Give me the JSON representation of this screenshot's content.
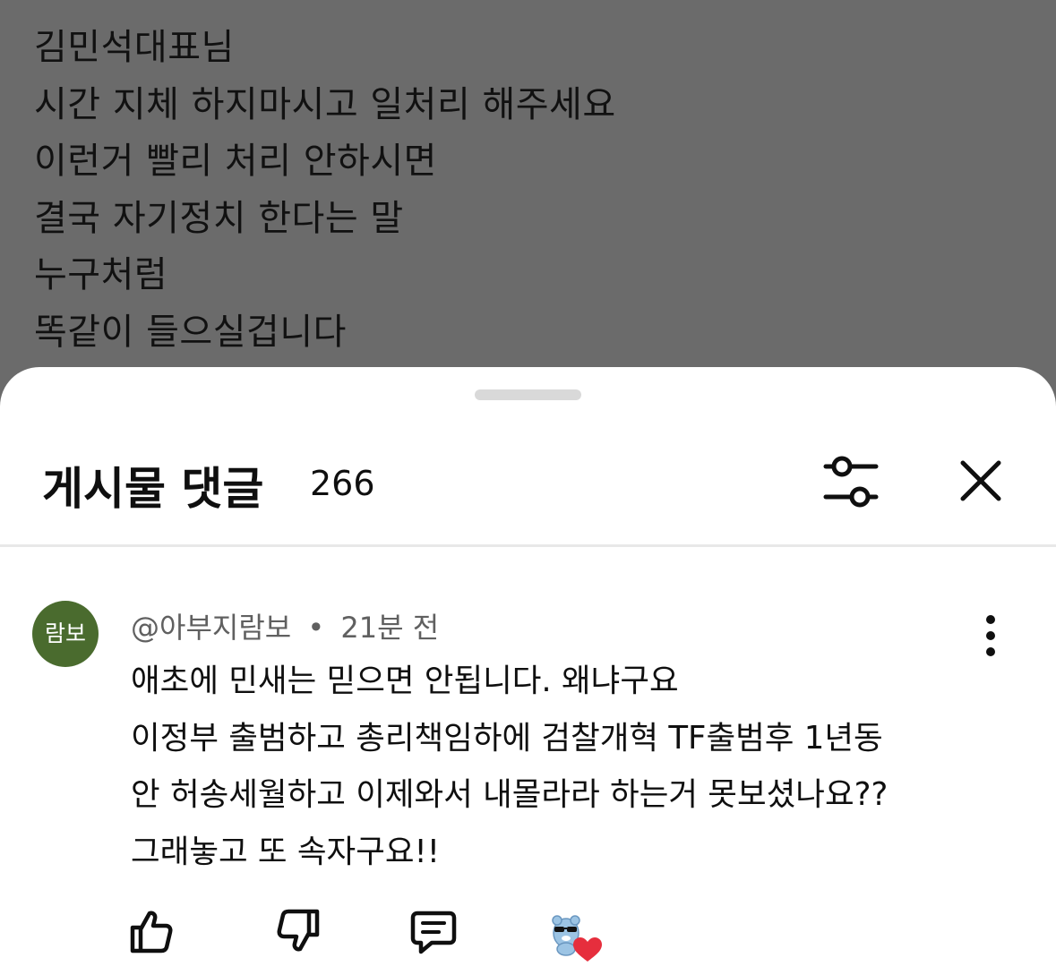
{
  "post": {
    "lines": [
      "김민석대표님",
      "시간 지체 하지마시고 일처리 해주세요",
      "이런거 빨리 처리 안하시면",
      "결국 자기정치 한다는 말",
      "누구처럼",
      "똑같이 들으실겁니다"
    ]
  },
  "sheet": {
    "title": "게시물 댓글",
    "count": "266"
  },
  "comment": {
    "avatar_text": "람보",
    "avatar_color": "#4a6b2e",
    "author": "@아부지람보",
    "separator": "•",
    "time": "21분 전",
    "lines": [
      "애초에 민새는 믿으면 안됩니다. 왜냐구요",
      "이정부 출범하고 총리책임하에 검찰개혁 TF출범후 1년동",
      "안 허송세월하고 이제와서 내몰라라 하는거 못보셨나요??",
      "그래놓고 또 속자구요!!"
    ]
  },
  "icons": {
    "filter": "sliders-icon",
    "close": "close-icon",
    "more": "more-vertical-icon",
    "like": "thumbs-up-icon",
    "dislike": "thumbs-down-icon",
    "reply": "reply-icon",
    "creator_heart": "creator-heart-icon"
  },
  "colors": {
    "heart": "#e62e3d"
  }
}
